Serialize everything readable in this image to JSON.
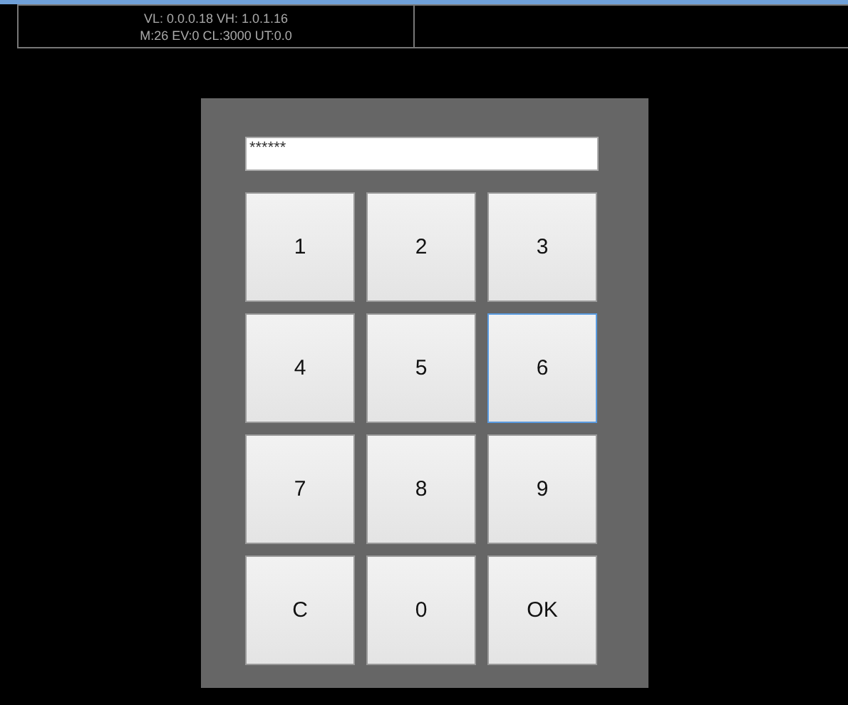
{
  "header": {
    "version": "VL: 0.0.0.18 VH: 1.0.1.16",
    "stats": "M:26 EV:0 CL:3000 UT:0.0"
  },
  "pin_field": {
    "value": "******"
  },
  "keys": [
    {
      "label": "1",
      "focused": false
    },
    {
      "label": "2",
      "focused": false
    },
    {
      "label": "3",
      "focused": false
    },
    {
      "label": "4",
      "focused": false
    },
    {
      "label": "5",
      "focused": false
    },
    {
      "label": "6",
      "focused": true
    },
    {
      "label": "7",
      "focused": false
    },
    {
      "label": "8",
      "focused": false
    },
    {
      "label": "9",
      "focused": false
    },
    {
      "label": "C",
      "focused": false
    },
    {
      "label": "0",
      "focused": false
    },
    {
      "label": "OK",
      "focused": false
    }
  ]
}
